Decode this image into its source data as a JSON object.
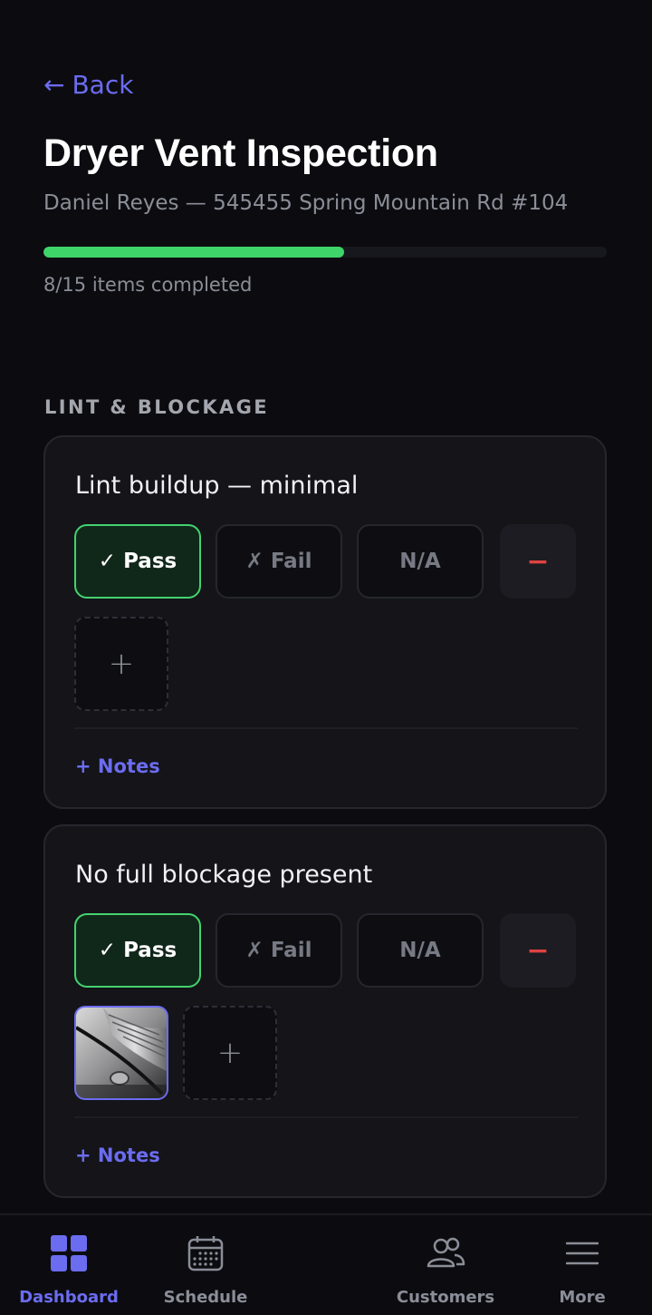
{
  "header": {
    "back_arrow": "←",
    "back_label": "Back",
    "title": "Dryer Vent Inspection",
    "subtitle": "Daniel Reyes — 545455 Spring Mountain Rd #104"
  },
  "progress": {
    "completed": 8,
    "total": 15,
    "fraction": 0.5333,
    "label": "8/15 items completed"
  },
  "section": {
    "title": "LINT & BLOCKAGE"
  },
  "items": [
    {
      "title": "Lint buildup — minimal",
      "selected": "pass",
      "pass_glyph": "✓",
      "pass_label": "Pass",
      "fail_glyph": "✗",
      "fail_label": "Fail",
      "na_label": "N/A",
      "remove_glyph": "−",
      "add_photo_glyph": "+",
      "notes_label": "+ Notes",
      "has_photo": false
    },
    {
      "title": "No full blockage present",
      "selected": "pass",
      "pass_glyph": "✓",
      "pass_label": "Pass",
      "fail_glyph": "✗",
      "fail_label": "Fail",
      "na_label": "N/A",
      "remove_glyph": "−",
      "add_photo_glyph": "+",
      "notes_label": "+ Notes",
      "has_photo": true
    }
  ],
  "tabbar": {
    "active": "dashboard",
    "tabs": [
      {
        "label": "Dashboard",
        "icon": "dashboard-grid-icon"
      },
      {
        "label": "Schedule",
        "icon": "calendar-icon"
      },
      {
        "label": "Customers",
        "icon": "customers-icon"
      },
      {
        "label": "More",
        "icon": "menu-icon"
      }
    ]
  },
  "colors": {
    "background": "#0c0c10",
    "accent": "#6b6cf0",
    "pass_green": "#43d36f",
    "progress_green": "#3fd46a",
    "remove_red": "#e04242",
    "muted_text": "#8b8e98"
  }
}
